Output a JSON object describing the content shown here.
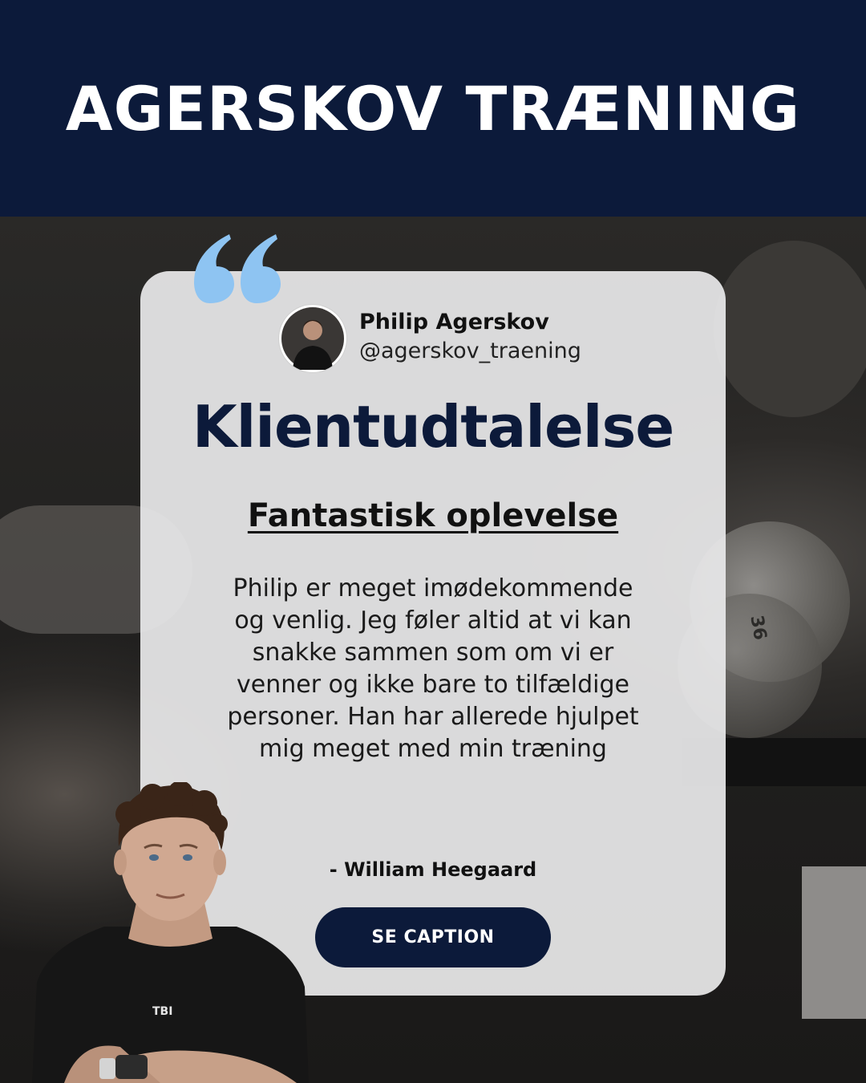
{
  "header": {
    "brand": "AGERSKOV TRÆNING",
    "background_color": "#0c1a3a"
  },
  "background_photo": {
    "plate_label": "36"
  },
  "card": {
    "quote_icon": "quote-marks-icon",
    "quote_icon_color": "#8ec4f2",
    "author": {
      "name": "Philip Agerskov",
      "handle": "@agerskov_traening"
    },
    "title": "Klientudtalelse",
    "subtitle": "Fantastisk oplevelse",
    "body": "Philip er meget imødekommende og venlig. Jeg føler altid at vi kan snakke sammen som om vi er venner og ikke bare to tilfældige personer. Han har allerede hjulpet mig meget med min træning",
    "signature": "- William Heegaard",
    "cta_label": "SE CAPTION"
  },
  "trainer_photo": {
    "shirt_text": "TBI"
  }
}
